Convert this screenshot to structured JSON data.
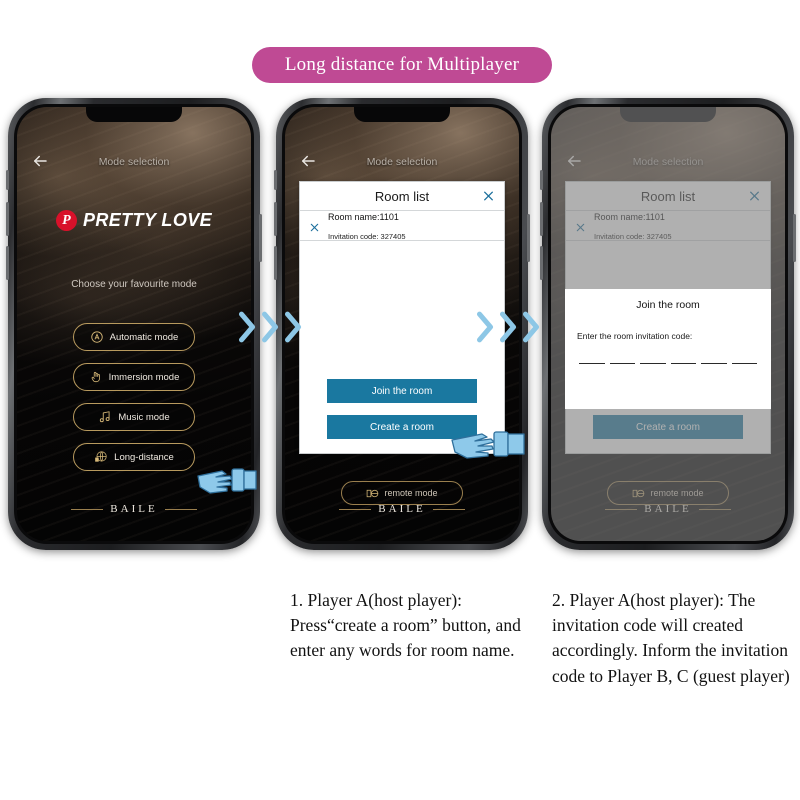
{
  "banner": {
    "title": "Long distance for Multiplayer",
    "color": "#bf4a94"
  },
  "app": {
    "header_title": "Mode selection",
    "back_icon": "back-arrow-icon",
    "brand_mark": "P",
    "brand_name": "PRETTY LOVE",
    "choose_prompt": "Choose your favourite mode",
    "footer_word": "BAILE",
    "remote_mode_label": "remote mode",
    "modes": [
      {
        "label": "Automatic mode",
        "icon": "letter-a-circle-icon"
      },
      {
        "label": "Immersion mode",
        "icon": "hand-touch-icon"
      },
      {
        "label": "Music mode",
        "icon": "music-note-icon"
      },
      {
        "label": "Long-distance",
        "icon": "globe-lock-icon"
      }
    ]
  },
  "room_dialog": {
    "title": "Room list",
    "close_icon": "close-icon",
    "rows": [
      {
        "remove_icon": "close-icon",
        "room_name_label": "Room name:",
        "room_name_value": "1101",
        "invitation_label": "Invitation code:",
        "invitation_value": "327405"
      }
    ],
    "buttons": {
      "join": "Join the room",
      "create": "Create a room"
    },
    "accent": "#1a78a0"
  },
  "join_modal": {
    "title": "Join the room",
    "label": "Enter the room invitation code:",
    "blank_count": 6
  },
  "arrows": {
    "icon": "chevron-right-icon",
    "color": "#8dc7e6",
    "groups": 2,
    "per_group": 3
  },
  "cursors": [
    {
      "name": "hand-pointer-icon",
      "target": "Long-distance"
    },
    {
      "name": "hand-pointer-icon",
      "target": "Create a room"
    }
  ],
  "captions": {
    "one": "1. Player A(host player): Press“create a room” button, and enter any words for room name.",
    "two": "2. Player A(host player): The invitation code will created accordingly. Inform the invitation code to Player B, C (guest player)"
  }
}
